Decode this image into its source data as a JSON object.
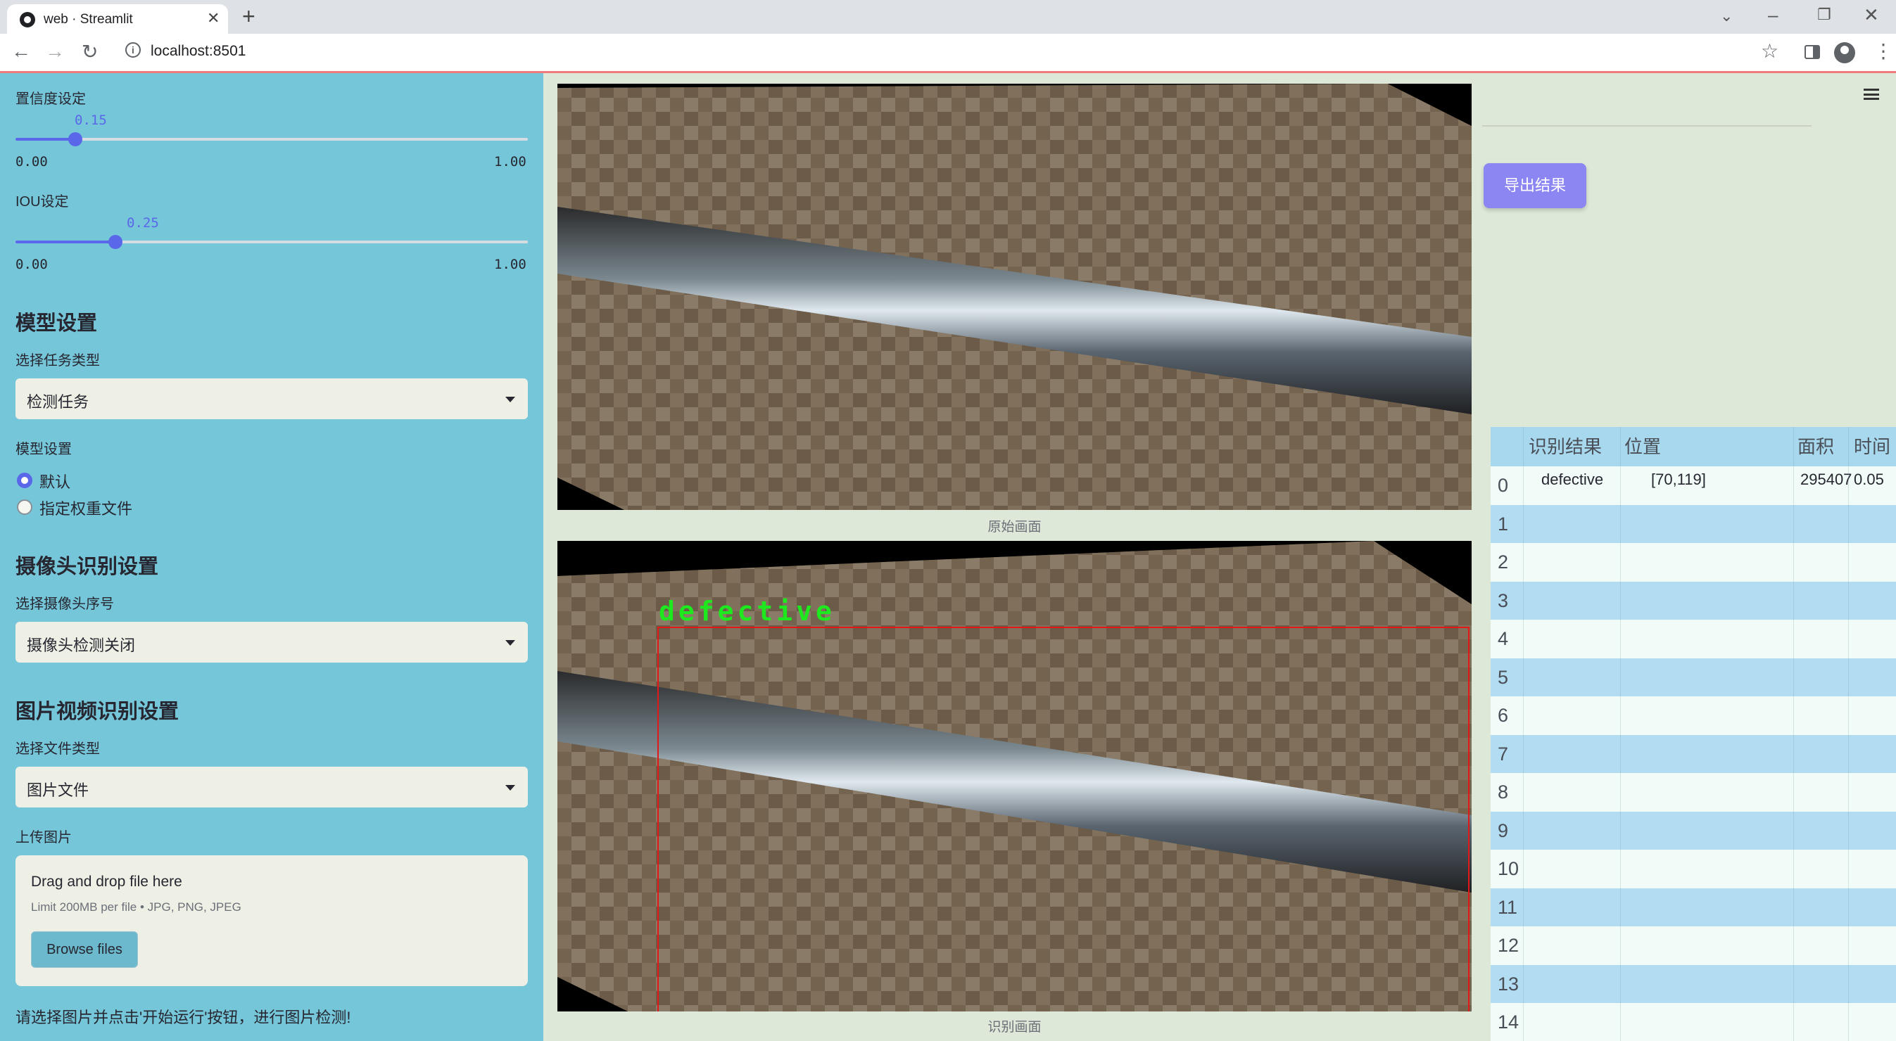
{
  "browser": {
    "tab_title": "web · Streamlit",
    "url": "localhost:8501"
  },
  "sidebar": {
    "confidence": {
      "label": "置信度设定",
      "value": "0.15",
      "value_fraction": 0.15,
      "min": "0.00",
      "max": "1.00"
    },
    "iou": {
      "label": "IOU设定",
      "value": "0.25",
      "value_fraction": 0.25,
      "min": "0.00",
      "max": "1.00"
    },
    "model_heading": "模型设置",
    "task_type_label": "选择任务类型",
    "task_type_value": "检测任务",
    "model_label": "模型设置",
    "model_options": [
      "默认",
      "指定权重文件"
    ],
    "model_selected": "默认",
    "camera_heading": "摄像头识别设置",
    "camera_label": "选择摄像头序号",
    "camera_value": "摄像头检测关闭",
    "media_heading": "图片视频识别设置",
    "file_type_label": "选择文件类型",
    "file_type_value": "图片文件",
    "upload_label": "上传图片",
    "upload_title": "Drag and drop file here",
    "upload_limit": "Limit 200MB per file • JPG, PNG, JPEG",
    "browse_label": "Browse files",
    "hint": "请选择图片并点击'开始运行'按钮，进行图片检测!"
  },
  "main": {
    "original_caption": "原始画面",
    "detected_caption": "识别画面",
    "detection_label": "defective",
    "export_label": "导出结果"
  },
  "results": {
    "columns": [
      "识别结果",
      "位置",
      "面积",
      "时间"
    ],
    "rows": [
      {
        "index": "0",
        "result": "defective",
        "position": "[70,119]",
        "area": "295407",
        "time": "0.05"
      },
      {
        "index": "1"
      },
      {
        "index": "2"
      },
      {
        "index": "3"
      },
      {
        "index": "4"
      },
      {
        "index": "5"
      },
      {
        "index": "6"
      },
      {
        "index": "7"
      },
      {
        "index": "8"
      },
      {
        "index": "9"
      },
      {
        "index": "10"
      },
      {
        "index": "11"
      },
      {
        "index": "12"
      },
      {
        "index": "13"
      },
      {
        "index": "14"
      }
    ]
  },
  "colors": {
    "sidebar_bg": "#76c6da",
    "accent": "#5a67e8",
    "export_button": "#8c86f2",
    "detection_box": "#e01818",
    "detection_text": "#1ee81e"
  }
}
